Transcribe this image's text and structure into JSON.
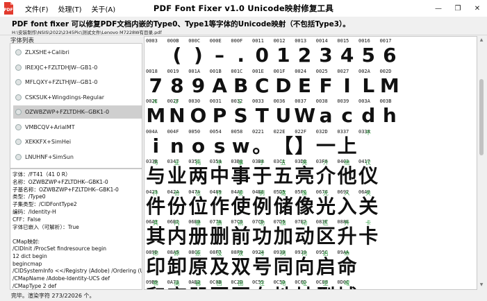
{
  "window": {
    "title": "PDF Font Fixer v1.0  Unicode映射修复工具",
    "menu": [
      "文件(F)",
      "处理(T)",
      "关于(A)"
    ],
    "controls": [
      "—",
      "❐",
      "✕"
    ]
  },
  "header": {
    "description": "PDF font fixer 可以修复PDF文档内嵌的Type0、Type1等字体的Unicode映射（不包括Type3）。",
    "path": "H:\\安装制作\\NSIS\\2022\\2345Pic\\测试文件\\Lenovo M7228W有目录.pdf"
  },
  "font_list": {
    "label": "字体列表",
    "items": [
      "ZLXSHE+Calibri",
      "IREXJC+FZLTDHJW--GB1-0",
      "MFLQXY+FZLTHJW--GB1-0",
      "CSKSUK+Wingdings-Regular",
      "OZWBZWP+FZLTDHK--GBK1-0",
      "VMBCQV+ArialMT",
      "XEKKFX+SimHei",
      "LNUHNF+SimSun"
    ],
    "selected_index": 4
  },
  "info": {
    "lines": [
      "字体：/FT41（41 0 R）",
      "名称：OZWBZWP+FZLTDHK--GBK1-0",
      "子基名称：OZWBZWP+FZLTDHK--GBK1-0",
      "类型：/Type0",
      "子集类型：/CIDFontType2",
      "编码：/Identity-H",
      "CFF：False",
      "字体已嵌入（可解析）：True",
      "",
      "CMap映射:",
      "/CIDInit /ProcSet findresource begin",
      "12 dict begin",
      "begincmap",
      "/CIDSystemInfo <</Registry (Adobe) /Ordering (U",
      "/CMapName /Adobe-Identity-UCS def",
      "/CMapType 2 def"
    ]
  },
  "glyph_grid": {
    "rows": [
      [
        [
          "0003",
          "",
          ""
        ],
        [
          "000B",
          "",
          "("
        ],
        [
          "000C",
          "",
          ")"
        ],
        [
          "000E",
          "",
          "–"
        ],
        [
          "000F",
          "",
          "."
        ],
        [
          "0011",
          "",
          "0"
        ],
        [
          "0012",
          "",
          "1"
        ],
        [
          "0013",
          "",
          "2"
        ],
        [
          "0014",
          "",
          "3"
        ],
        [
          "0015",
          "",
          "4"
        ],
        [
          "0016",
          "",
          "5"
        ],
        [
          "0017",
          "",
          "6"
        ]
      ],
      [
        [
          "0018",
          "",
          "7"
        ],
        [
          "0019",
          "",
          "8"
        ],
        [
          "001A",
          "",
          "9"
        ],
        [
          "001B",
          "",
          "A"
        ],
        [
          "001C",
          "",
          "B"
        ],
        [
          "001E",
          "",
          "C"
        ],
        [
          "001F",
          "",
          "D"
        ],
        [
          "0024",
          "",
          "E"
        ],
        [
          "0025",
          "",
          "F"
        ],
        [
          "0027",
          "",
          "I"
        ],
        [
          "002A",
          "",
          "L"
        ],
        [
          "002D",
          "",
          "M"
        ]
      ],
      [
        [
          "002E",
          "N",
          "M"
        ],
        [
          "002F",
          "O",
          "N"
        ],
        [
          "0030",
          "",
          "O"
        ],
        [
          "0031",
          "",
          "P"
        ],
        [
          "0032",
          "S",
          "S"
        ],
        [
          "0033",
          "",
          "T"
        ],
        [
          "0036",
          "",
          "U"
        ],
        [
          "0037",
          "",
          "W"
        ],
        [
          "0038",
          "",
          "a"
        ],
        [
          "0039",
          "",
          "c"
        ],
        [
          "003A",
          "",
          "d"
        ],
        [
          "003B",
          "",
          "h"
        ]
      ],
      [
        [
          "004A",
          "",
          "i"
        ],
        [
          "004F",
          "",
          "n"
        ],
        [
          "0050",
          "",
          "o"
        ],
        [
          "0054",
          "",
          "s"
        ],
        [
          "0058",
          "",
          "w"
        ],
        [
          "0221",
          "",
          "。"
        ],
        [
          "022E",
          "",
          "【"
        ],
        [
          "022F",
          "",
          "】"
        ],
        [
          "032D",
          "",
          "一"
        ],
        [
          "0337",
          "",
          "上"
        ],
        [
          "0338",
          "不",
          ""
        ],
        [
          "",
          "",
          " "
        ]
      ],
      [
        [
          "033B",
          "与",
          "与"
        ],
        [
          "0347",
          "业",
          "业"
        ],
        [
          "0351",
          "两",
          "两"
        ],
        [
          "0354",
          "中",
          "中"
        ],
        [
          "03B8",
          "事",
          "事"
        ],
        [
          "03B8",
          "于",
          "于"
        ],
        [
          "03C1",
          "五",
          "五"
        ],
        [
          "03DB",
          "亮",
          "亮"
        ],
        [
          "03F8",
          "介",
          "介"
        ],
        [
          "0403",
          "他",
          "他"
        ],
        [
          "0417",
          "仪",
          "仪"
        ],
        [
          "",
          "",
          " "
        ]
      ],
      [
        [
          "0423",
          "件",
          "件"
        ],
        [
          "042A",
          "份",
          "份"
        ],
        [
          "047A",
          "位",
          "位"
        ],
        [
          "0489",
          "作",
          "作"
        ],
        [
          "04AC",
          "使",
          "使"
        ],
        [
          "04B8",
          "例",
          "例"
        ],
        [
          "05D5",
          "储",
          "储"
        ],
        [
          "05FC",
          "像",
          "像"
        ],
        [
          "0676",
          "光",
          "光"
        ],
        [
          "0692",
          "入",
          "入"
        ],
        [
          "06A0",
          "关",
          "关"
        ],
        [
          "",
          "",
          " "
        ]
      ],
      [
        [
          "06A3",
          "其",
          "其"
        ],
        [
          "06B2",
          "内",
          "内"
        ],
        [
          "06B9",
          "册",
          "册"
        ],
        [
          "077A",
          "删",
          "删"
        ],
        [
          "07C0",
          "前",
          "前"
        ],
        [
          "07CD",
          "功",
          "功"
        ],
        [
          "07D5",
          "加",
          "加"
        ],
        [
          "07E7",
          "动",
          "动"
        ],
        [
          "083E",
          "区",
          "区"
        ],
        [
          "088E",
          "升",
          "升"
        ],
        [
          "",
          "卡",
          "卡"
        ],
        [
          "",
          "",
          " "
        ]
      ],
      [
        [
          "089D",
          "印",
          "印"
        ],
        [
          "08A5",
          "卸",
          "卸"
        ],
        [
          "08CC",
          "原",
          "原"
        ],
        [
          "08F7",
          "及",
          "及"
        ],
        [
          "08F9",
          "双",
          "双"
        ],
        [
          "0924",
          "号",
          "号"
        ],
        [
          "0939",
          "同",
          "同"
        ],
        [
          "0939",
          "向",
          "向"
        ],
        [
          "095C",
          "启",
          "启"
        ],
        [
          "09AA",
          "命",
          "命"
        ],
        [
          "",
          "",
          " "
        ],
        [
          "",
          "",
          " "
        ]
      ],
      [
        [
          "09B9",
          "和",
          "和"
        ],
        [
          "0A73",
          "商",
          "商"
        ],
        [
          "0AB2",
          "器",
          "器"
        ],
        [
          "0C0B",
          "回",
          "回"
        ],
        [
          "0C2B",
          "图",
          "图"
        ],
        [
          "0C55",
          "在",
          "在"
        ],
        [
          "0C5D",
          "地",
          "地"
        ],
        [
          "0C6D",
          "址",
          "址"
        ],
        [
          "0C88",
          "型",
          "型"
        ],
        [
          "0D0C",
          "域",
          "域"
        ],
        [
          "",
          "",
          " "
        ],
        [
          "",
          "",
          " "
        ]
      ]
    ]
  },
  "status": "完毕。渲染字符 273/22026 个。"
}
